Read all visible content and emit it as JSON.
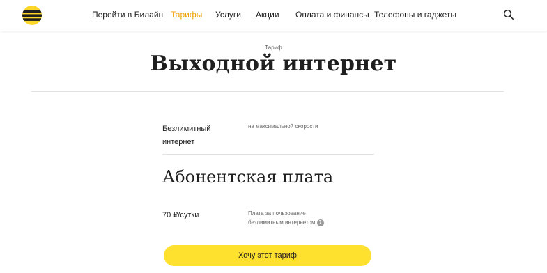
{
  "header": {
    "nav": [
      {
        "label": "Перейти в Билайн",
        "active": false
      },
      {
        "label": "Тарифы",
        "active": true
      },
      {
        "label": "Услуги",
        "active": false
      },
      {
        "label": "Акции",
        "active": false
      },
      {
        "label": "Оплата и финансы",
        "active": false
      },
      {
        "label": "Телефоны и гаджеты",
        "active": false
      }
    ],
    "search_icon": "search-icon",
    "logo_icon": "beeline-logo"
  },
  "page": {
    "eyebrow": "Тариф",
    "title": "Выходной интернет"
  },
  "feature": {
    "name_line1": "Безлимитный",
    "name_line2": "интернет",
    "description": "на максимальной скорости"
  },
  "fee": {
    "section_title": "Абонентская плата",
    "price": "70 ₽/сутки",
    "description_line1": "Плата за пользование",
    "description_line2": "безлимитным интернетом",
    "help_icon": "?"
  },
  "cta": {
    "label": "Хочу этот тариф"
  },
  "colors": {
    "accent": "#f0a30a",
    "button": "#fee02f"
  }
}
